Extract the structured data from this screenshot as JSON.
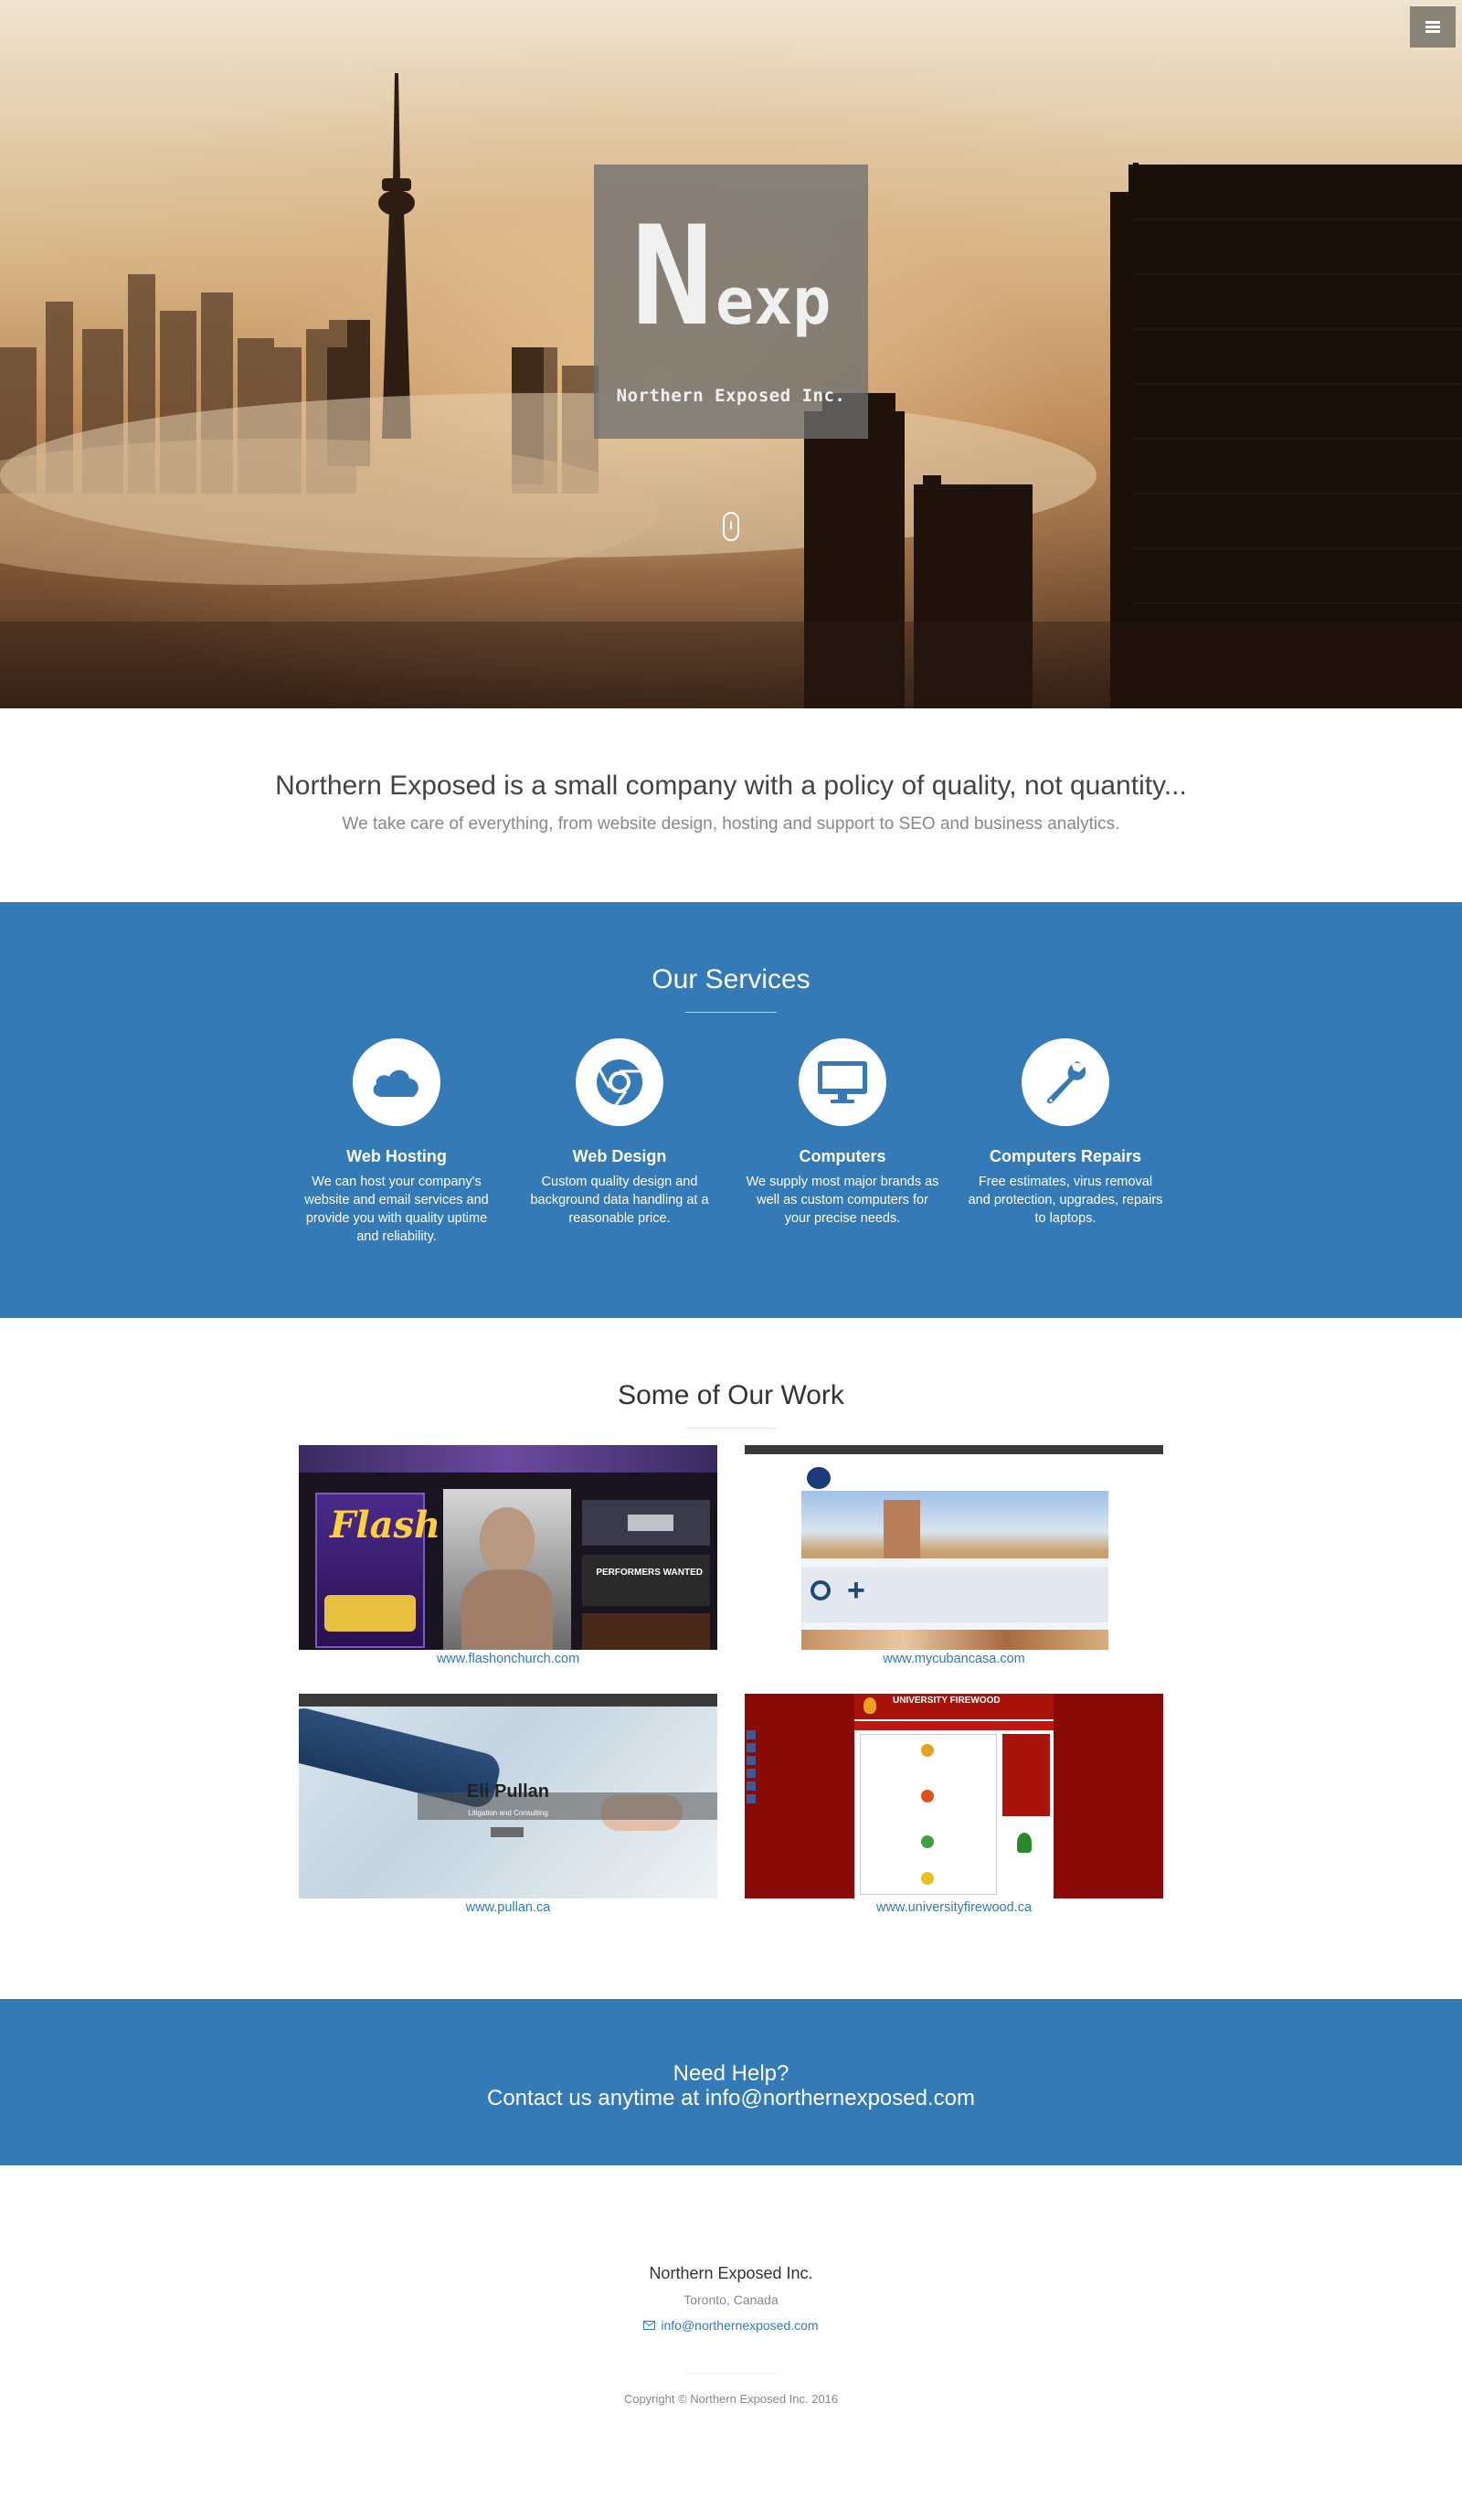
{
  "hero": {
    "logo_n": "N",
    "logo_exp": "exp",
    "logo_subtitle": "Northern Exposed Inc.",
    "menu_icon": "hamburger-icon",
    "scroll_icon": "mouse-scroll-icon"
  },
  "intro": {
    "headline": "Northern Exposed is a small company with a policy of quality, not quantity...",
    "subline": "We take care of everything, from website design, hosting and support to SEO and business analytics."
  },
  "services": {
    "title": "Our Services",
    "items": [
      {
        "icon": "cloud-icon",
        "title": "Web Hosting",
        "text": "We can host your company's website and email services and provide you with quality uptime and reliability."
      },
      {
        "icon": "chrome-icon",
        "title": "Web Design",
        "text": "Custom quality design and background data handling at a reasonable price."
      },
      {
        "icon": "desktop-icon",
        "title": "Computers",
        "text": "We supply most major brands as well as custom computers for your precise needs."
      },
      {
        "icon": "wrench-icon",
        "title": "Computers Repairs",
        "text": "Free estimates, virus removal and protection, upgrades, repairs to laptops."
      }
    ]
  },
  "work": {
    "title": "Some of Our Work",
    "items": [
      {
        "link": "www.flashonchurch.com",
        "t1_flash": "Flash",
        "t1_performers": "PERFORMERS WANTED"
      },
      {
        "link": "www.mycubancasa.com"
      },
      {
        "link": "www.pullan.ca",
        "t3_name": "Eli Pullan",
        "t3_tagline": "Litigation and Consulting"
      },
      {
        "link": "www.universityfirewood.ca",
        "t4_title": "UNIVERSITY FIREWOOD"
      }
    ]
  },
  "help": {
    "line1": "Need Help?",
    "line2": "Contact us anytime at info@northernexposed.com"
  },
  "footer": {
    "company": "Northern Exposed Inc.",
    "location": "Toronto, Canada",
    "email": "info@northernexposed.com",
    "email_icon": "envelope-icon",
    "copyright": "Copyright © Northern Exposed Inc. 2016"
  },
  "colors": {
    "brand_blue": "#337ab7",
    "white": "#ffffff"
  }
}
